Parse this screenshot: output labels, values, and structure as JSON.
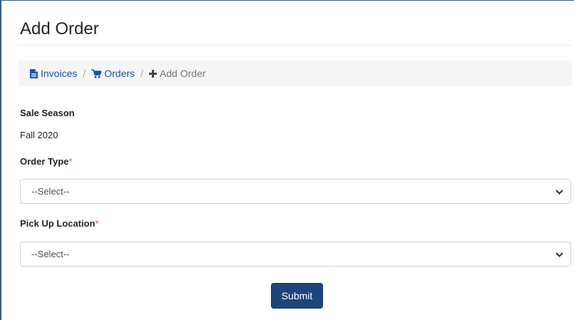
{
  "page": {
    "title": "Add Order"
  },
  "breadcrumb": {
    "items": [
      {
        "label": "Invoices",
        "icon": "file-icon"
      },
      {
        "label": "Orders",
        "icon": "cart-icon"
      },
      {
        "label": "Add Order",
        "icon": "plus-icon"
      }
    ],
    "separator": "/"
  },
  "form": {
    "sale_season": {
      "label": "Sale Season",
      "value": "Fall 2020"
    },
    "order_type": {
      "label": "Order Type",
      "required_mark": "*",
      "selected": "--Select--"
    },
    "pickup_location": {
      "label": "Pick Up Location",
      "required_mark": "*",
      "selected": "--Select--"
    },
    "submit_label": "Submit"
  },
  "colors": {
    "link": "#1e4fa8",
    "primary_button": "#1d4579",
    "required": "#d9534f",
    "breadcrumb_bg": "#f5f5f5"
  }
}
